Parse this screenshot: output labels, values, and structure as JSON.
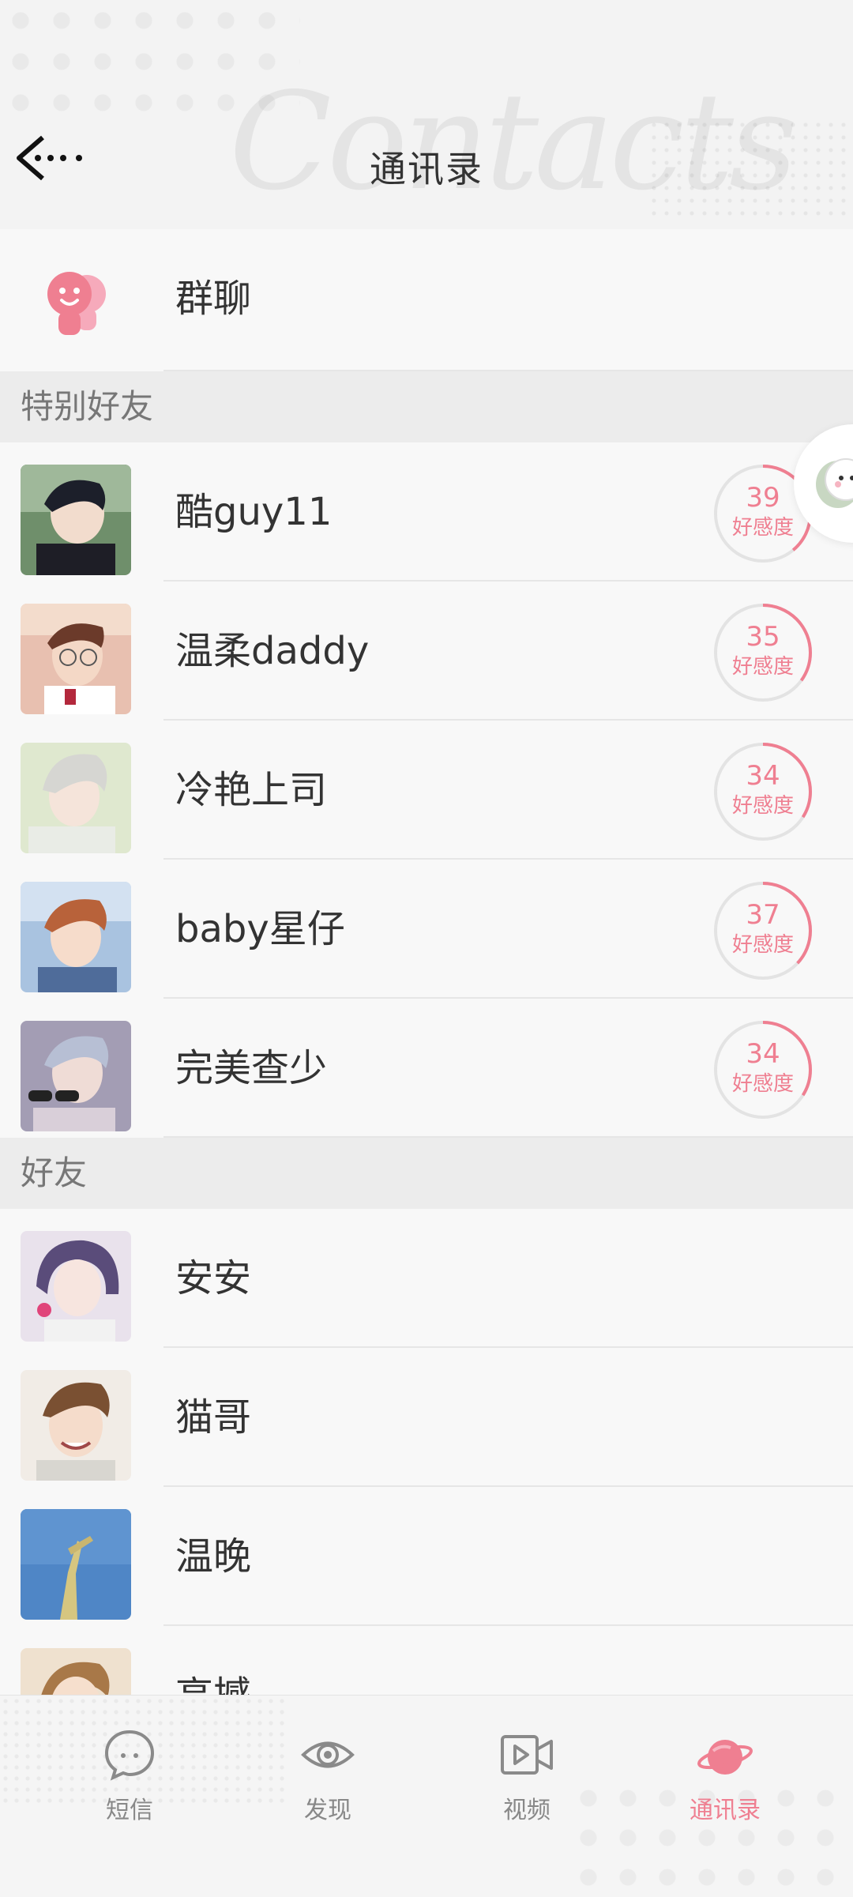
{
  "header": {
    "title": "通讯录",
    "watermark": "Contacts"
  },
  "group_chat": {
    "label": "群聊"
  },
  "sections": {
    "special": "特别好友",
    "friends": "好友"
  },
  "special_friends": [
    {
      "name": "酷guy11",
      "favor": "39",
      "favor_label": "好感度",
      "favor_fraction": 0.39
    },
    {
      "name": "温柔daddy",
      "favor": "35",
      "favor_label": "好感度",
      "favor_fraction": 0.35
    },
    {
      "name": "冷艳上司",
      "favor": "34",
      "favor_label": "好感度",
      "favor_fraction": 0.34
    },
    {
      "name": "baby星仔",
      "favor": "37",
      "favor_label": "好感度",
      "favor_fraction": 0.37
    },
    {
      "name": "完美查少",
      "favor": "34",
      "favor_label": "好感度",
      "favor_fraction": 0.34
    }
  ],
  "friends": [
    {
      "name": "安安"
    },
    {
      "name": "猫哥"
    },
    {
      "name": "温晚"
    },
    {
      "name": "高撼"
    }
  ],
  "bottom_nav": [
    {
      "label": "短信",
      "icon": "chat-bubble-icon",
      "active": false
    },
    {
      "label": "发现",
      "icon": "eye-icon",
      "active": false
    },
    {
      "label": "视频",
      "icon": "video-icon",
      "active": false
    },
    {
      "label": "通讯录",
      "icon": "planet-icon",
      "active": true
    }
  ],
  "colors": {
    "accent": "#ef7f91",
    "ring_track": "#e3e3e3"
  }
}
